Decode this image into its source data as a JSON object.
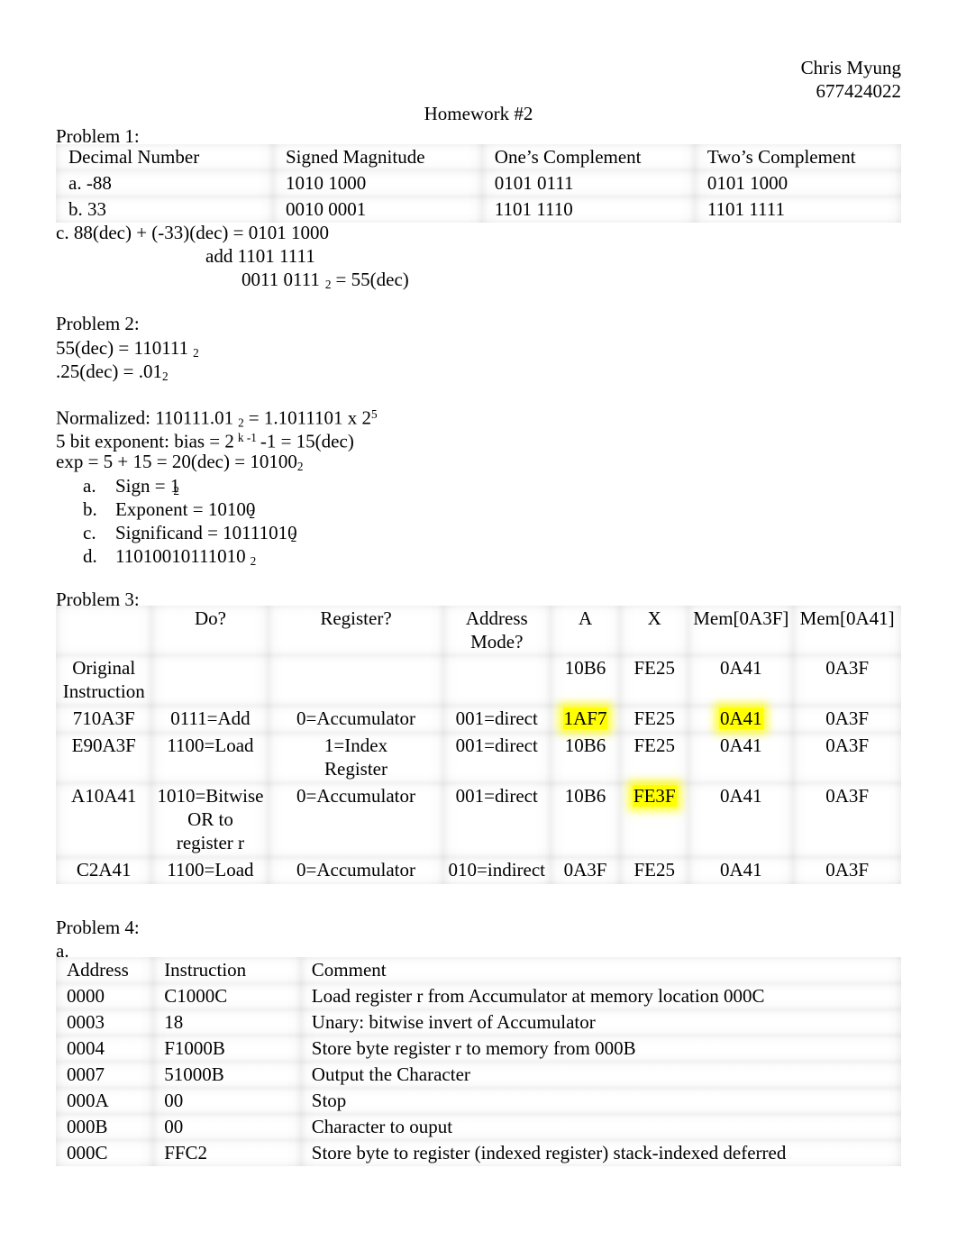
{
  "header": {
    "student_name": "Chris Myung",
    "student_id": "677424022",
    "title": "Homework #2"
  },
  "problem1": {
    "label": "Problem 1:",
    "table": {
      "columns": [
        "Decimal Number",
        "Signed Magnitude",
        "One’s Complement",
        "Two’s Complement"
      ],
      "rows": [
        [
          "a. -88",
          "1010 1000",
          "0101 0111",
          "0101 1000"
        ],
        [
          "b. 33",
          "0010 0001",
          "1101 1110",
          "1101 1111"
        ]
      ]
    },
    "part_c_line1": "c. 88(dec) + (-33)(dec) = 0101 1000",
    "part_c_line2": "add 1101 1111",
    "part_c_line3_value": "0011 0111",
    "part_c_line3_sub": "2",
    "part_c_line3_tail": "= 55(dec)"
  },
  "problem2": {
    "label": "Problem 2:",
    "line1_pre": "55(dec) = 110111",
    "line1_sub": "2",
    "line2_pre": ".25(dec) = .01",
    "line2_sub": "2",
    "normalized_pre": "Normalized: 110111.01",
    "normalized_sub": "2",
    "normalized_mid": "= 1.1011101 x 2",
    "normalized_sup": "5",
    "bias_pre": "5 bit exponent: bias = 2",
    "bias_sup": "k -1",
    "bias_tail": "-1 = 15(dec)",
    "exp_pre": "exp = 5 + 15 = 20(dec) = 10100",
    "exp_sub": "2",
    "items": [
      {
        "marker": "a.",
        "text": "Sign = 1",
        "sub": "2",
        "overlap": true
      },
      {
        "marker": "b.",
        "text": "Exponent = 10100",
        "sub": "2",
        "overlap": true
      },
      {
        "marker": "c.",
        "text": "Significand = 10111010",
        "sub": "2",
        "overlap": true
      },
      {
        "marker": "d.",
        "text": "11010010111010",
        "sub": "2",
        "overlap": false
      }
    ]
  },
  "problem3": {
    "label": "Problem 3:",
    "columns": [
      "",
      "Do?",
      "Register?",
      "Address Mode?",
      "A",
      "X",
      "Mem[0A3F]",
      "Mem[0A41]"
    ],
    "rows": [
      {
        "cells": [
          "Original Instruction",
          "",
          "",
          "",
          "10B6",
          "FE25",
          "0A41",
          "0A3F"
        ],
        "highlight": []
      },
      {
        "cells": [
          "710A3F",
          "0111=Add",
          "0=Accumulator",
          "001=direct",
          "1AF7",
          "FE25",
          "0A41",
          "0A3F"
        ],
        "highlight": [
          4,
          6
        ]
      },
      {
        "cells": [
          "E90A3F",
          "1100=Load",
          "1=Index Register",
          "001=direct",
          "10B6",
          "FE25",
          "0A41",
          "0A3F"
        ],
        "highlight": []
      },
      {
        "cells": [
          "A10A41",
          "1010=Bitwise OR to register r",
          "0=Accumulator",
          "001=direct",
          "10B6",
          "FE3F",
          "0A41",
          "0A3F"
        ],
        "highlight": [
          5
        ]
      },
      {
        "cells": [
          "C2A41",
          "1100=Load",
          "0=Accumulator",
          "010=indirect",
          "0A3F",
          "FE25",
          "0A41",
          "0A3F"
        ],
        "highlight": []
      }
    ]
  },
  "problem4": {
    "label": "Problem 4:",
    "part": "a.",
    "columns": [
      "Address",
      "Instruction",
      "Comment"
    ],
    "rows": [
      [
        "0000",
        "C1000C",
        "Load register r from Accumulator at memory location 000C"
      ],
      [
        "0003",
        "18",
        "Unary: bitwise invert of Accumulator"
      ],
      [
        "0004",
        "F1000B",
        "Store byte register r to memory from 000B"
      ],
      [
        "0007",
        "51000B",
        "Output the Character"
      ],
      [
        "000A",
        "00",
        "Stop"
      ],
      [
        "000B",
        "00",
        "Character to ouput"
      ],
      [
        "000C",
        "FFC2",
        "Store byte to register (indexed register) stack-indexed deferred"
      ]
    ]
  },
  "colors": {
    "highlight": "#ffff00",
    "text": "#000000",
    "page_background": "#ffffff"
  }
}
